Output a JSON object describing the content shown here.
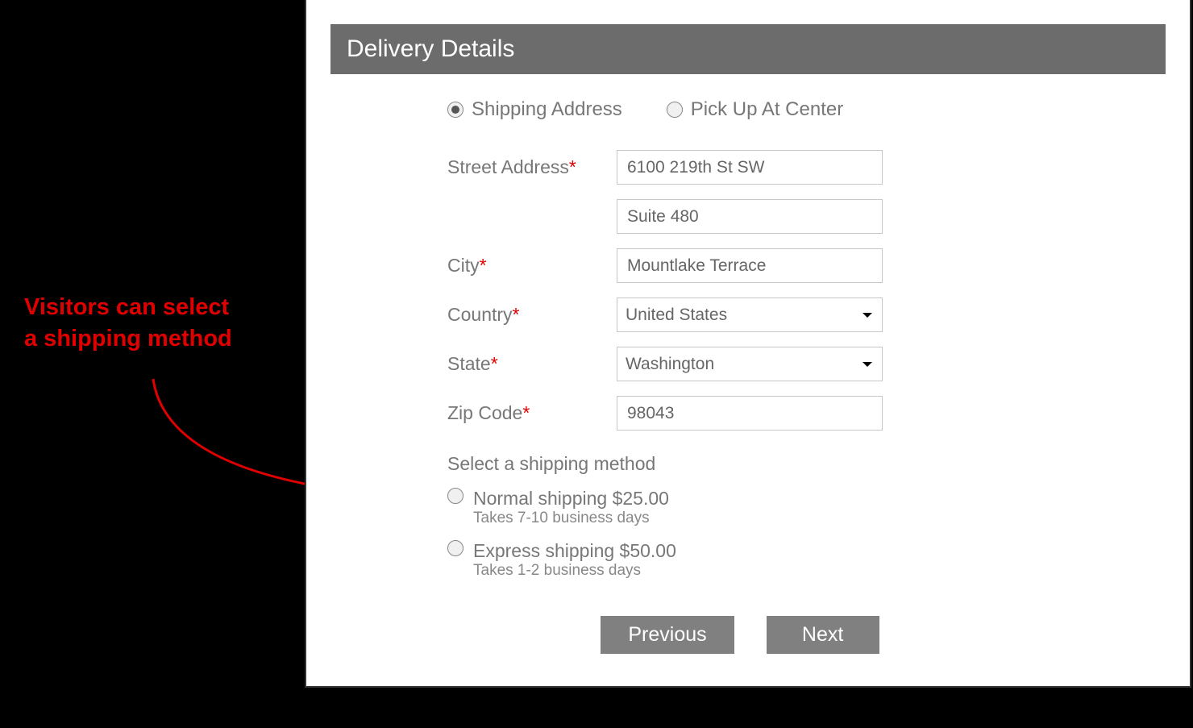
{
  "header": {
    "title": "Delivery Details"
  },
  "deliveryMode": {
    "options": [
      {
        "label": "Shipping Address",
        "checked": true
      },
      {
        "label": "Pick Up At Center",
        "checked": false
      }
    ]
  },
  "fields": {
    "street": {
      "label": "Street Address",
      "required": true,
      "line1": "6100 219th St SW",
      "line2": "Suite 480"
    },
    "city": {
      "label": "City",
      "required": true,
      "value": "Mountlake Terrace"
    },
    "country": {
      "label": "Country",
      "required": true,
      "value": "United States"
    },
    "state": {
      "label": "State",
      "required": true,
      "value": "Washington"
    },
    "zip": {
      "label": "Zip Code",
      "required": true,
      "value": "98043"
    }
  },
  "shipping": {
    "section_label": "Select a shipping method",
    "options": [
      {
        "title": "Normal shipping $25.00",
        "sub": "Takes 7-10 business days"
      },
      {
        "title": "Express shipping $50.00",
        "sub": "Takes 1-2 business days"
      }
    ]
  },
  "buttons": {
    "previous": "Previous",
    "next": "Next"
  },
  "annotation": {
    "line1": "Visitors can select",
    "line2": "a shipping method"
  }
}
